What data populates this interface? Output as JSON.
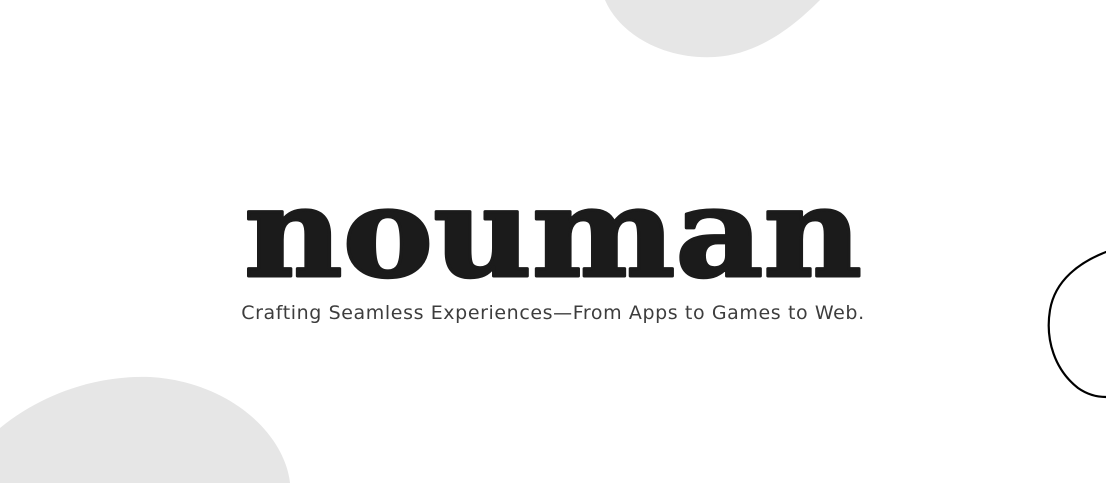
{
  "brand": {
    "wordmark": "nouman",
    "tagline": "Crafting Seamless Experiences—From Apps to Games to Web."
  },
  "colors": {
    "background": "#ffffff",
    "wordmark": "#1b1b1b",
    "tagline": "#3d3d3d",
    "blob_fill": "#e6e6e6",
    "outline_stroke": "#000000"
  },
  "icons": {
    "decor_top": "gray-blob",
    "decor_bottom": "gray-blob",
    "decor_right": "outline-blob"
  }
}
